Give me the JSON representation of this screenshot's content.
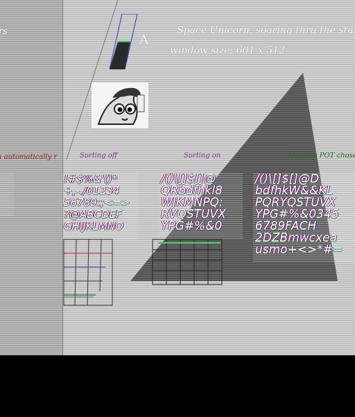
{
  "header": {
    "title": "Space Unicorn, soaring thru the star",
    "window_size": "window size: 601 x 512",
    "meter_letter": "A",
    "left_fragment": "rs"
  },
  "labels": {
    "left": "n automatically r",
    "sorting_off": "Sorting off",
    "sorting_on": "Sorting on",
    "pot": "Multiple POT chose"
  },
  "glyphs": {
    "block1": "!#$%&'()*\n+,-./01234\n56789:;<=>\n?@ABCDEF\nGHIJKLMNO",
    "block2": "/()\\[]$[]@\nQRbdfhkl8\nWJKMNPQ:\nRVQSTUVX\nYPG#%&0",
    "block3": "/()\\[]$[]@D\nbdfhkW&&KL\nPQRYQSTUVX\nYPG#%&0345\n6789FACH\n2DZBmwcxea\nusmo+<>*#="
  },
  "colors": {
    "background": "#c6c6c6",
    "left_panel": "#adadad",
    "triangle": "#4a4a4a",
    "label_left": "#8a2020",
    "label_sorting": "#7a3a80",
    "label_pot": "#2a6a2a"
  }
}
